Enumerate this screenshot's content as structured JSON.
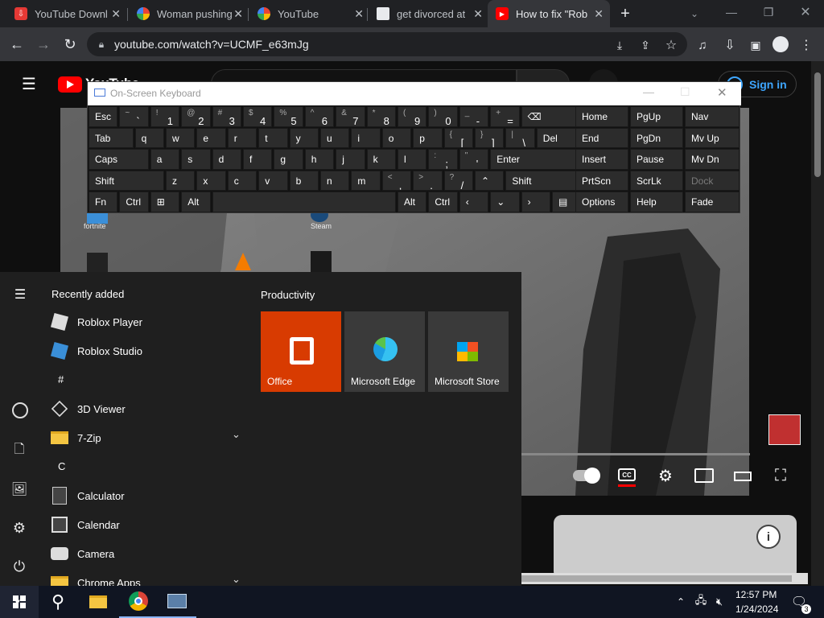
{
  "tabs": [
    {
      "title": "YouTube Downl",
      "icon": "download-icon",
      "color": "#e53935"
    },
    {
      "title": "Woman pushing",
      "icon": "google-icon",
      "color": "#ffffff"
    },
    {
      "title": "YouTube",
      "icon": "google-icon",
      "color": "#ffffff"
    },
    {
      "title": "get divorced at",
      "icon": "page-icon",
      "color": "#ffffff"
    },
    {
      "title": "How to fix \"Rob",
      "icon": "youtube-icon",
      "color": "#ff0000"
    }
  ],
  "address": "youtube.com/watch?v=UCMF_e63mJg",
  "youtube": {
    "logo_text": "YouTube",
    "sign_in": "Sign in"
  },
  "osk": {
    "title": "On-Screen Keyboard",
    "rows": [
      [
        {
          "l": "Esc",
          "w": 1
        },
        {
          "s": "~",
          "m": "`",
          "w": 1
        },
        {
          "s": "!",
          "m": "1",
          "w": 1
        },
        {
          "s": "@",
          "m": "2",
          "w": 1
        },
        {
          "s": "#",
          "m": "3",
          "w": 1
        },
        {
          "s": "$",
          "m": "4",
          "w": 1
        },
        {
          "s": "%",
          "m": "5",
          "w": 1
        },
        {
          "s": "^",
          "m": "6",
          "w": 1
        },
        {
          "s": "&",
          "m": "7",
          "w": 1
        },
        {
          "s": "*",
          "m": "8",
          "w": 1
        },
        {
          "s": "(",
          "m": "9",
          "w": 1
        },
        {
          "s": ")",
          "m": "0",
          "w": 1
        },
        {
          "s": "_",
          "m": "-",
          "w": 1
        },
        {
          "s": "+",
          "m": "=",
          "w": 1
        },
        {
          "l": "⌫",
          "w": 2
        }
      ],
      [
        {
          "l": "Tab",
          "w": 1.5
        },
        {
          "l": "q",
          "w": 1
        },
        {
          "l": "w",
          "w": 1
        },
        {
          "l": "e",
          "w": 1
        },
        {
          "l": "r",
          "w": 1
        },
        {
          "l": "t",
          "w": 1
        },
        {
          "l": "y",
          "w": 1
        },
        {
          "l": "u",
          "w": 1
        },
        {
          "l": "i",
          "w": 1
        },
        {
          "l": "o",
          "w": 1
        },
        {
          "l": "p",
          "w": 1
        },
        {
          "s": "{",
          "m": "[",
          "w": 1
        },
        {
          "s": "}",
          "m": "]",
          "w": 1
        },
        {
          "s": "|",
          "m": "\\",
          "w": 1
        },
        {
          "l": "Del",
          "w": 1.5
        }
      ],
      [
        {
          "l": "Caps",
          "w": 2
        },
        {
          "l": "a",
          "w": 1
        },
        {
          "l": "s",
          "w": 1
        },
        {
          "l": "d",
          "w": 1
        },
        {
          "l": "f",
          "w": 1
        },
        {
          "l": "g",
          "w": 1
        },
        {
          "l": "h",
          "w": 1
        },
        {
          "l": "j",
          "w": 1
        },
        {
          "l": "k",
          "w": 1
        },
        {
          "l": "l",
          "w": 1
        },
        {
          "s": ":",
          "m": ";",
          "w": 1
        },
        {
          "s": "\"",
          "m": "'",
          "w": 1
        },
        {
          "l": "Enter",
          "w": 3
        }
      ],
      [
        {
          "l": "Shift",
          "w": 2.5
        },
        {
          "l": "z",
          "w": 1
        },
        {
          "l": "x",
          "w": 1
        },
        {
          "l": "c",
          "w": 1
        },
        {
          "l": "v",
          "w": 1
        },
        {
          "l": "b",
          "w": 1
        },
        {
          "l": "n",
          "w": 1
        },
        {
          "l": "m",
          "w": 1
        },
        {
          "s": "<",
          "m": ",",
          "w": 1
        },
        {
          "s": ">",
          "m": ".",
          "w": 1
        },
        {
          "s": "?",
          "m": "/",
          "w": 1
        },
        {
          "l": "⌃",
          "w": 1
        },
        {
          "l": "Shift",
          "w": 2.5
        }
      ],
      [
        {
          "l": "Fn",
          "w": 1
        },
        {
          "l": "Ctrl",
          "w": 1
        },
        {
          "l": "⊞",
          "w": 1
        },
        {
          "l": "Alt",
          "w": 1
        },
        {
          "l": "",
          "w": 6
        },
        {
          "l": "Alt",
          "w": 1
        },
        {
          "l": "Ctrl",
          "w": 1
        },
        {
          "l": "‹",
          "w": 1
        },
        {
          "l": "⌄",
          "w": 1
        },
        {
          "l": "›",
          "w": 1
        },
        {
          "l": "▤",
          "w": 1
        }
      ]
    ],
    "nav": [
      [
        "Home",
        "PgUp",
        "Nav"
      ],
      [
        "End",
        "PgDn",
        "Mv Up"
      ],
      [
        "Insert",
        "Pause",
        "Mv Dn"
      ],
      [
        "PrtScn",
        "ScrLk",
        "Dock"
      ],
      [
        "Options",
        "Help",
        "Fade"
      ]
    ]
  },
  "start": {
    "recently_added": "Recently added",
    "productivity": "Productivity",
    "apps": [
      {
        "name": "Roblox Player",
        "icon": "roblox-player-icon",
        "type": "app"
      },
      {
        "name": "Roblox Studio",
        "icon": "roblox-studio-icon",
        "type": "app"
      },
      {
        "name": "#",
        "type": "letter"
      },
      {
        "name": "3D Viewer",
        "icon": "cube-icon",
        "type": "app"
      },
      {
        "name": "7-Zip",
        "icon": "folder-icon",
        "type": "folder"
      },
      {
        "name": "C",
        "type": "letter"
      },
      {
        "name": "Calculator",
        "icon": "calculator-icon",
        "type": "app"
      },
      {
        "name": "Calendar",
        "icon": "calendar-icon",
        "type": "app"
      },
      {
        "name": "Camera",
        "icon": "camera-icon",
        "type": "app"
      },
      {
        "name": "Chrome Apps",
        "icon": "folder-icon",
        "type": "folder"
      }
    ],
    "tiles": [
      {
        "name": "Office",
        "color": "#d83b01"
      },
      {
        "name": "Microsoft Edge",
        "color": "#3a3a3a"
      },
      {
        "name": "Microsoft Store",
        "color": "#3a3a3a"
      }
    ]
  },
  "desktop_icons": [
    "fortnite",
    "Steam"
  ],
  "tray": {
    "time": "12:57 PM",
    "date": "1/24/2024",
    "notifications": "3"
  }
}
